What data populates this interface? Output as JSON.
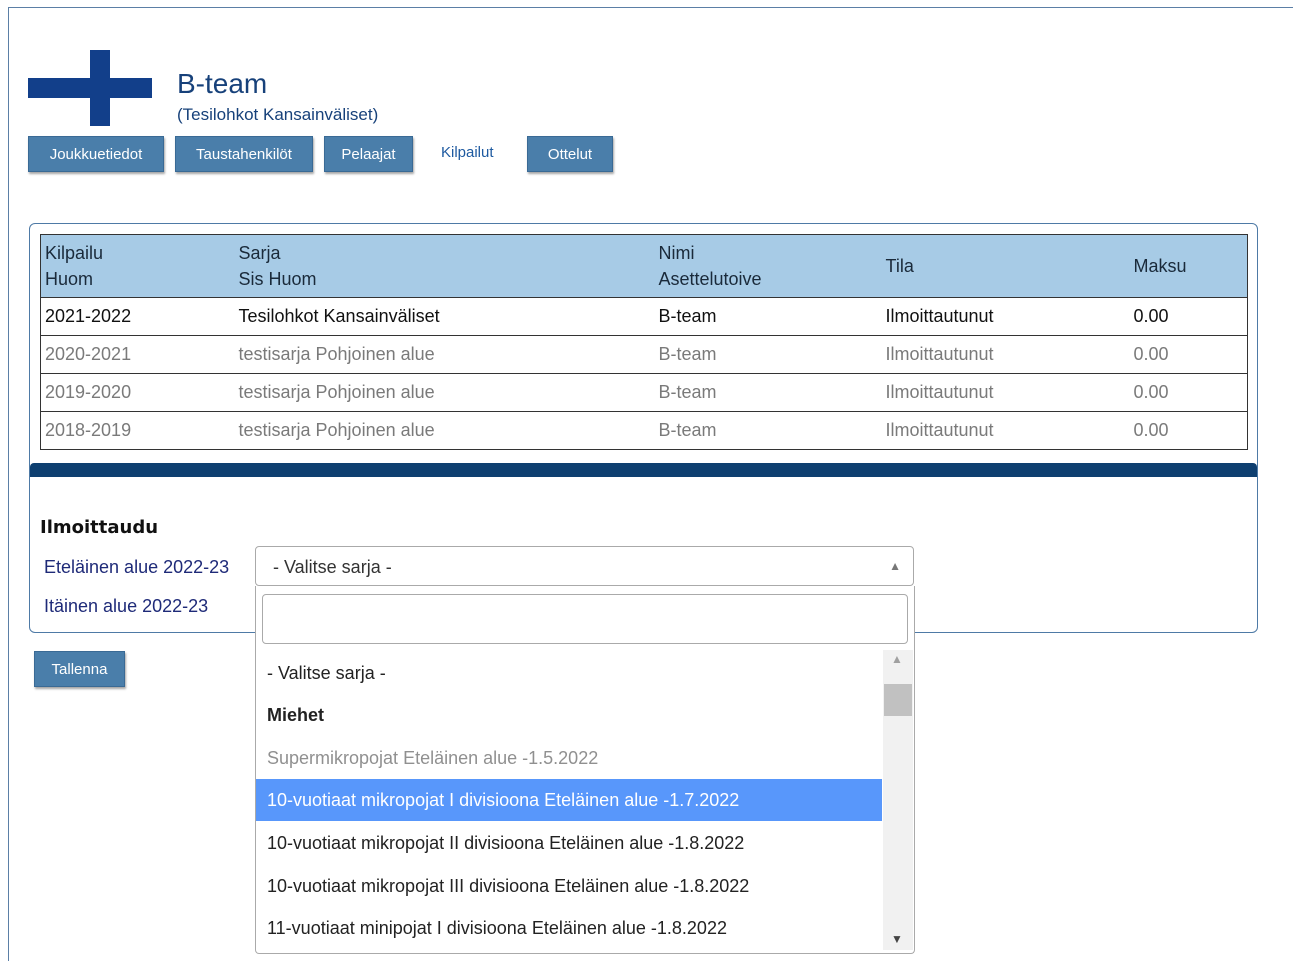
{
  "team": {
    "name": "B-team",
    "subtitle": "(Tesilohkot Kansainväliset)"
  },
  "nav": {
    "team_info": "Joukkuetiedot",
    "staff": "Taustahenkilöt",
    "players": "Pelaajat",
    "competitions": "Kilpailut",
    "matches": "Ottelut"
  },
  "table": {
    "headers": {
      "competition": "Kilpailu",
      "note": "Huom",
      "series": "Sarja",
      "internal_note": "Sis Huom",
      "name": "Nimi",
      "placement_wish": "Asettelutoive",
      "status": "Tila",
      "fee": "Maksu"
    },
    "rows": [
      {
        "season": "2021-2022",
        "series": "Tesilohkot Kansainväliset",
        "name": "B-team",
        "status": "Ilmoittautunut",
        "fee": "0.00"
      },
      {
        "season": "2020-2021",
        "series": "testisarja Pohjoinen alue",
        "name": "B-team",
        "status": "Ilmoittautunut",
        "fee": "0.00"
      },
      {
        "season": "2019-2020",
        "series": "testisarja Pohjoinen alue",
        "name": "B-team",
        "status": "Ilmoittautunut",
        "fee": "0.00"
      },
      {
        "season": "2018-2019",
        "series": "testisarja Pohjoinen alue",
        "name": "B-team",
        "status": "Ilmoittautunut",
        "fee": "0.00"
      }
    ]
  },
  "register": {
    "title": "Ilmoittaudu",
    "regions": [
      "Eteläinen alue 2022-23",
      "Itäinen alue 2022-23"
    ],
    "select_value": "- Valitse sarja -",
    "search_value": "",
    "options": {
      "placeholder": "- Valitse sarja -",
      "group": "Miehet",
      "items": [
        "Supermikropojat Eteläinen alue -1.5.2022",
        "10-vuotiaat mikropojat I divisioona Eteläinen alue -1.7.2022",
        "10-vuotiaat mikropojat II divisioona Eteläinen alue -1.8.2022",
        "10-vuotiaat mikropojat III divisioona Eteläinen alue -1.8.2022",
        "11-vuotiaat minipojat I divisioona Eteläinen alue -1.8.2022"
      ]
    },
    "save_label": "Tallenna"
  }
}
